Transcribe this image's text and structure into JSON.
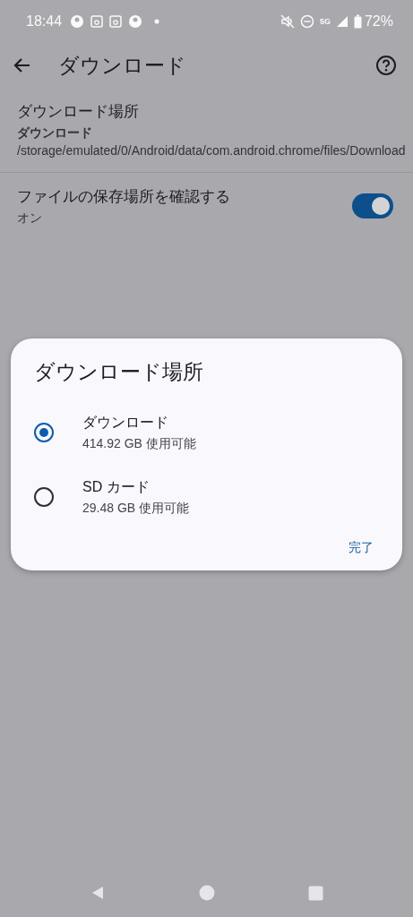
{
  "status_bar": {
    "time": "18:44",
    "notifications": [
      {
        "kind": "circle"
      },
      {
        "kind": "square"
      },
      {
        "kind": "square"
      },
      {
        "kind": "circle"
      },
      {
        "kind": "dot"
      }
    ],
    "network": "5G",
    "battery": "72%"
  },
  "app_bar": {
    "title": "ダウンロード"
  },
  "settings": [
    {
      "kind": "text",
      "title": "ダウンロード場所",
      "summary": "**ダウンロード** /storage/emulated/0/Android/data/com.android.chrome/files/Download"
    },
    {
      "kind": "switch",
      "title": "ファイルの保存場所を確認する",
      "summary": "オン",
      "on": true
    }
  ],
  "dialog": {
    "title": "ダウンロード場所",
    "options": [
      {
        "label": "ダウンロード",
        "detail": "414.92 GB 使用可能",
        "selected": true
      },
      {
        "label": "SD カード",
        "detail": "29.48 GB 使用可能",
        "selected": false
      }
    ],
    "button": "完了"
  }
}
